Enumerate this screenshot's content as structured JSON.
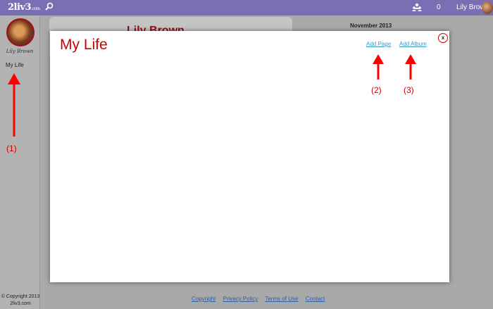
{
  "topbar": {
    "logo": "2liv3",
    "logo_suffix": ".com",
    "notification_count": "0",
    "user_name": "Lily Brown"
  },
  "sidebar": {
    "profile_name": "Lily Brown",
    "nav_item": "My Life",
    "copyright_line1": "© Copyright 2013",
    "copyright_line2": "2liv3.com"
  },
  "background": {
    "profile_title": "Lily Brown",
    "month": "November 2013"
  },
  "footer": {
    "links": [
      "Copyright",
      "Privacy Policy",
      "Terms of Use",
      "Contact"
    ]
  },
  "modal": {
    "title": "My Life",
    "add_page": "Add Page",
    "add_album": "Add Album",
    "close": "x"
  },
  "annotations": {
    "label1": "(1)",
    "label2": "(2)",
    "label3": "(3)",
    "color": "#ff0000"
  },
  "colors": {
    "topbar": "#7a6fb2",
    "accent_red": "#cc0000",
    "link_blue": "#3399cc"
  }
}
